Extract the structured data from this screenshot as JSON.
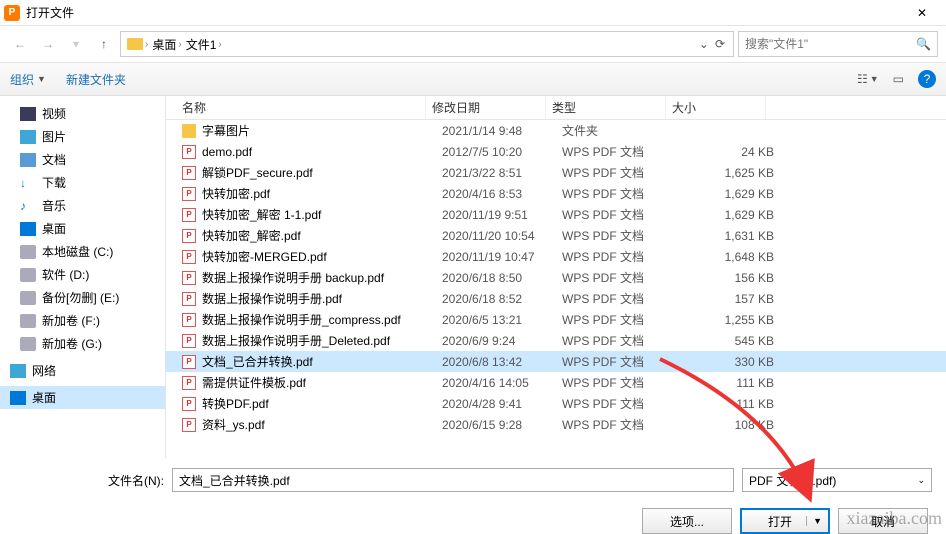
{
  "titlebar": {
    "app_glyph": "P",
    "title": "打开文件",
    "close_glyph": "✕"
  },
  "breadcrumb": {
    "segments": [
      "桌面",
      "文件1"
    ]
  },
  "search": {
    "placeholder": "搜索\"文件1\""
  },
  "toolbar": {
    "organize": "组织",
    "newfolder": "新建文件夹"
  },
  "sidebar": {
    "items": [
      {
        "label": "视频",
        "ico": "vid"
      },
      {
        "label": "图片",
        "ico": "pic"
      },
      {
        "label": "文档",
        "ico": "doc"
      },
      {
        "label": "下载",
        "ico": "dl"
      },
      {
        "label": "音乐",
        "ico": "music"
      },
      {
        "label": "桌面",
        "ico": "desk"
      },
      {
        "label": "本地磁盘 (C:)",
        "ico": "disk"
      },
      {
        "label": "软件 (D:)",
        "ico": "disk"
      },
      {
        "label": "备份[勿删] (E:)",
        "ico": "disk"
      },
      {
        "label": "新加卷 (F:)",
        "ico": "disk"
      },
      {
        "label": "新加卷 (G:)",
        "ico": "disk"
      }
    ],
    "network": "网络",
    "desktop": "桌面"
  },
  "columns": {
    "name": "名称",
    "date": "修改日期",
    "type": "类型",
    "size": "大小"
  },
  "files": [
    {
      "name": "字幕图片",
      "date": "2021/1/14 9:48",
      "type": "文件夹",
      "size": "",
      "ico": "fold"
    },
    {
      "name": "demo.pdf",
      "date": "2012/7/5 10:20",
      "type": "WPS PDF 文档",
      "size": "24 KB",
      "ico": "pdf"
    },
    {
      "name": "解锁PDF_secure.pdf",
      "date": "2021/3/22 8:51",
      "type": "WPS PDF 文档",
      "size": "1,625 KB",
      "ico": "pdf"
    },
    {
      "name": "快转加密.pdf",
      "date": "2020/4/16 8:53",
      "type": "WPS PDF 文档",
      "size": "1,629 KB",
      "ico": "pdf"
    },
    {
      "name": "快转加密_解密 1-1.pdf",
      "date": "2020/11/19 9:51",
      "type": "WPS PDF 文档",
      "size": "1,629 KB",
      "ico": "pdf"
    },
    {
      "name": "快转加密_解密.pdf",
      "date": "2020/11/20 10:54",
      "type": "WPS PDF 文档",
      "size": "1,631 KB",
      "ico": "pdf"
    },
    {
      "name": "快转加密-MERGED.pdf",
      "date": "2020/11/19 10:47",
      "type": "WPS PDF 文档",
      "size": "1,648 KB",
      "ico": "pdf"
    },
    {
      "name": "数据上报操作说明手册 backup.pdf",
      "date": "2020/6/18 8:50",
      "type": "WPS PDF 文档",
      "size": "156 KB",
      "ico": "pdf"
    },
    {
      "name": "数据上报操作说明手册.pdf",
      "date": "2020/6/18 8:52",
      "type": "WPS PDF 文档",
      "size": "157 KB",
      "ico": "pdf"
    },
    {
      "name": "数据上报操作说明手册_compress.pdf",
      "date": "2020/6/5 13:21",
      "type": "WPS PDF 文档",
      "size": "1,255 KB",
      "ico": "pdf"
    },
    {
      "name": "数据上报操作说明手册_Deleted.pdf",
      "date": "2020/6/9 9:24",
      "type": "WPS PDF 文档",
      "size": "545 KB",
      "ico": "pdf"
    },
    {
      "name": "文档_已合并转换.pdf",
      "date": "2020/6/8 13:42",
      "type": "WPS PDF 文档",
      "size": "330 KB",
      "ico": "pdf",
      "selected": true
    },
    {
      "name": "需提供证件模板.pdf",
      "date": "2020/4/16 14:05",
      "type": "WPS PDF 文档",
      "size": "111 KB",
      "ico": "pdf"
    },
    {
      "name": "转换PDF.pdf",
      "date": "2020/4/28 9:41",
      "type": "WPS PDF 文档",
      "size": "111 KB",
      "ico": "pdf"
    },
    {
      "name": "资料_ys.pdf",
      "date": "2020/6/15 9:28",
      "type": "WPS PDF 文档",
      "size": "108 KB",
      "ico": "pdf"
    }
  ],
  "filename": {
    "label": "文件名(N):",
    "value": "文档_已合并转换.pdf"
  },
  "filter": {
    "value": "PDF 文档 (*.pdf)"
  },
  "buttons": {
    "options": "选项...",
    "open": "打开",
    "cancel": "取消"
  },
  "watermark": "xiazaiba.com"
}
